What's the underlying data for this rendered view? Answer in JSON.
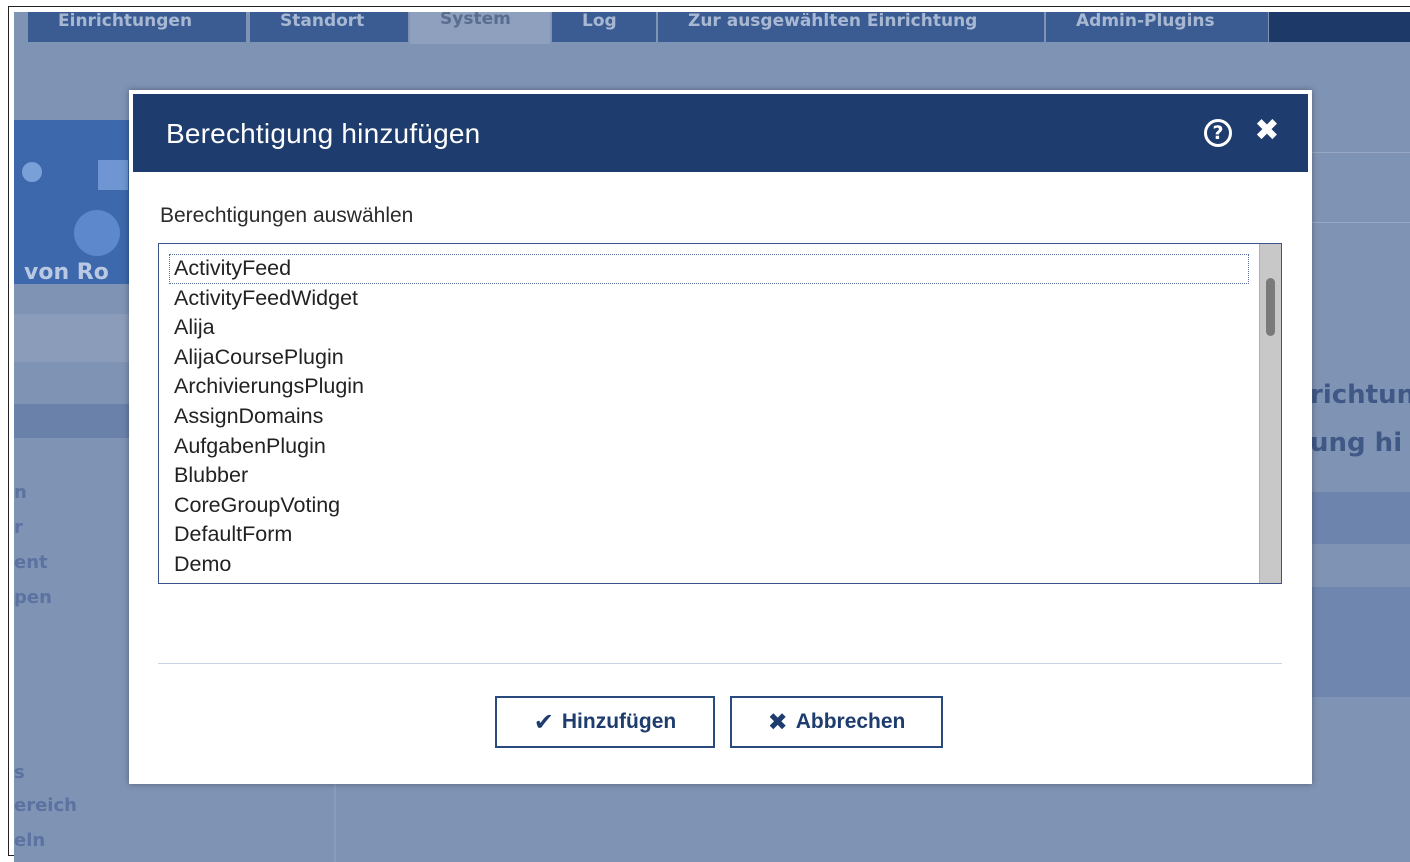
{
  "background": {
    "tabs": [
      "Einrichtungen",
      "Standort",
      "System",
      "Log",
      "Zur ausgewählten Einrichtung",
      "Admin-Plugins"
    ],
    "logo_text": "von Ro",
    "sidebar_fragments": [
      "n",
      "r",
      "ent",
      "pen",
      "s",
      "ereich",
      "eln"
    ],
    "right_fragments": [
      "richtun",
      "ung hi"
    ]
  },
  "dialog": {
    "title": "Berechtigung hinzufügen",
    "help_icon": "help-icon",
    "close_icon": "close-icon",
    "list_label": "Berechtigungen auswählen",
    "list_items": [
      "ActivityFeed",
      "ActivityFeedWidget",
      "Alija",
      "AlijaCoursePlugin",
      "ArchivierungsPlugin",
      "AssignDomains",
      "AufgabenPlugin",
      "Blubber",
      "CoreGroupVoting",
      "DefaultForm",
      "Demo"
    ],
    "focused_item": "ActivityFeed",
    "buttons": {
      "add_label": "Hinzufügen",
      "add_icon": "check-icon",
      "cancel_label": "Abbrechen",
      "cancel_icon": "x-icon"
    }
  },
  "colors": {
    "header": "#1e3c6e",
    "overlay": "#7f93b4",
    "button_border": "#2a4a7e"
  }
}
